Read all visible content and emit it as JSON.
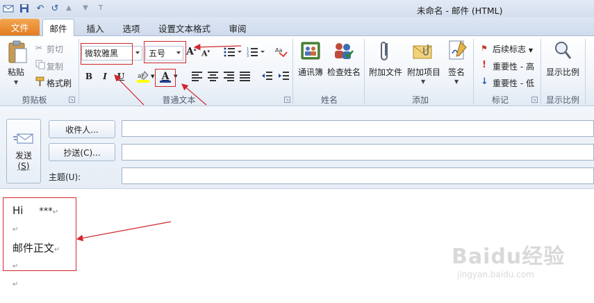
{
  "window": {
    "title": "未命名 - 邮件 (HTML)"
  },
  "tabs": [
    {
      "label": "文件"
    },
    {
      "label": "邮件"
    },
    {
      "label": "插入"
    },
    {
      "label": "选项"
    },
    {
      "label": "设置文本格式"
    },
    {
      "label": "审阅"
    }
  ],
  "ribbon": {
    "clipboard": {
      "paste": "粘贴",
      "cut": "剪切",
      "copy": "复制",
      "format_painter": "格式刷",
      "group_label": "剪贴板"
    },
    "basic_text": {
      "font_name": "微软雅黑",
      "font_size": "五号",
      "bold": "B",
      "italic": "I",
      "underline": "U",
      "font_color_glyph": "A",
      "grow_glyph": "A",
      "shrink_glyph": "A",
      "group_label": "普通文本"
    },
    "names": {
      "address_book": "通讯簿",
      "check_names": "检查姓名",
      "group_label": "姓名"
    },
    "include": {
      "attach_file": "附加文件",
      "attach_item": "附加项目",
      "signature": "签名",
      "group_label": "添加"
    },
    "tags": {
      "follow_up": "后续标志",
      "high_importance": "重要性 - 高",
      "low_importance": "重要性 - 低",
      "group_label": "标记"
    },
    "zoom": {
      "zoom": "显示比例",
      "group_label": "显示比例"
    }
  },
  "compose": {
    "send": "发送",
    "send_accel": "(S)",
    "to_button": "收件人...",
    "cc_button": "抄送(C)...",
    "subject_label": "主题(U):",
    "to_value": "",
    "cc_value": "",
    "subject_value": ""
  },
  "body": {
    "line1_hi": "Hi",
    "line1_stars": "***",
    "line3": "邮件正文",
    "para_mark": "↵"
  },
  "watermark": {
    "main": "Baidu经验",
    "sub": "jingyan.baidu.com"
  },
  "colors": {
    "file_tab": "#e37c20",
    "annotation": "#d0272c",
    "font_color": "#1f3f99",
    "highlight": "#ffff00"
  }
}
